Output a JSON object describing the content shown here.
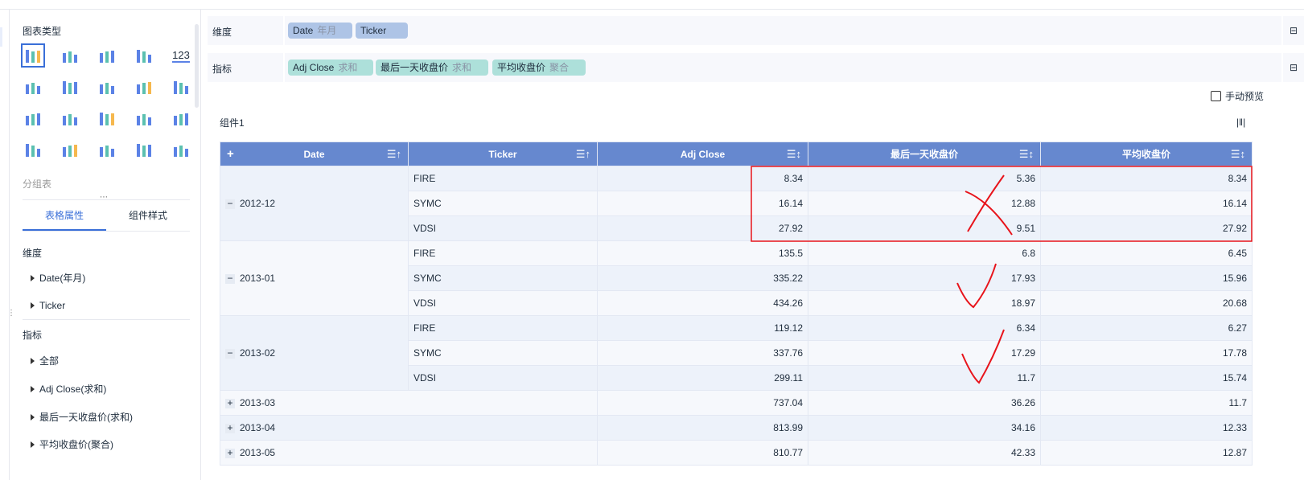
{
  "sidebar": {
    "chart_type_title": "图表类型",
    "group_table": "分组表",
    "tabs": [
      "表格属性",
      "组件样式"
    ],
    "dimension_title": "维度",
    "dimension_items": [
      "Date(年月)",
      "Ticker"
    ],
    "metric_title": "指标",
    "metric_items": [
      "全部",
      "Adj Close(求和)",
      "最后一天收盘价(求和)",
      "平均收盘价(聚合)"
    ]
  },
  "shelves": {
    "dimension": {
      "label": "维度",
      "pills": [
        {
          "name": "Date",
          "sub": "年月"
        },
        {
          "name": "Ticker",
          "sub": ""
        }
      ]
    },
    "metric": {
      "label": "指标",
      "pills": [
        {
          "name": "Adj Close",
          "sub": "求和"
        },
        {
          "name": "最后一天收盘价",
          "sub": "求和"
        },
        {
          "name": "平均收盘价",
          "sub": "聚合"
        }
      ]
    }
  },
  "manual_preview": "手动预览",
  "component_title": "组件1",
  "table": {
    "columns": [
      "Date",
      "Ticker",
      "Adj Close",
      "最后一天收盘价",
      "平均收盘价"
    ],
    "groups": [
      {
        "date": "2012-12",
        "expanded": true,
        "rows": [
          [
            "FIRE",
            "8.34",
            "5.36",
            "8.34"
          ],
          [
            "SYMC",
            "16.14",
            "12.88",
            "16.14"
          ],
          [
            "VDSI",
            "27.92",
            "9.51",
            "27.92"
          ]
        ]
      },
      {
        "date": "2013-01",
        "expanded": true,
        "rows": [
          [
            "FIRE",
            "135.5",
            "6.8",
            "6.45"
          ],
          [
            "SYMC",
            "335.22",
            "17.93",
            "15.96"
          ],
          [
            "VDSI",
            "434.26",
            "18.97",
            "20.68"
          ]
        ]
      },
      {
        "date": "2013-02",
        "expanded": true,
        "rows": [
          [
            "FIRE",
            "119.12",
            "6.34",
            "6.27"
          ],
          [
            "SYMC",
            "337.76",
            "17.29",
            "17.78"
          ],
          [
            "VDSI",
            "299.11",
            "11.7",
            "15.74"
          ]
        ]
      },
      {
        "date": "2013-03",
        "expanded": false,
        "rows": [
          [
            "",
            "737.04",
            "36.26",
            "11.7"
          ]
        ]
      },
      {
        "date": "2013-04",
        "expanded": false,
        "rows": [
          [
            "",
            "813.99",
            "34.16",
            "12.33"
          ]
        ]
      },
      {
        "date": "2013-05",
        "expanded": false,
        "rows": [
          [
            "",
            "810.77",
            "42.33",
            "12.87"
          ]
        ]
      }
    ]
  },
  "colors": {
    "accent": "#3a6fd8",
    "header": "#6688cf",
    "annotation": "#e8141b"
  }
}
